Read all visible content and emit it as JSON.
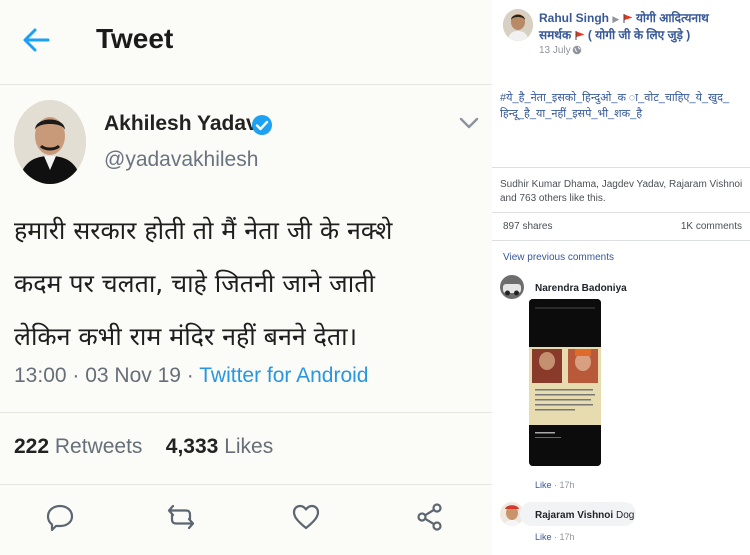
{
  "tweet": {
    "header_title": "Tweet",
    "author_name": "Akhilesh Yadav",
    "author_handle": "@yadavakhilesh",
    "body_lines": [
      "हमारी सरकार होती तो मैं नेता जी के नक्शे",
      "कदम पर चलता, चाहे जितनी जाने जाती",
      "लेकिन कभी राम मंदिर नहीं बनने देता।"
    ],
    "time": "13:00 · 03 Nov 19 · ",
    "source": "Twitter for Android",
    "retweets_count": "222",
    "retweets_label": "Retweets",
    "likes_count": "4,333",
    "likes_label": "Likes",
    "accent_color": "#1da1f2"
  },
  "facebook": {
    "poster_name": "Rahul Singh",
    "group_name": "योगी आदित्यनाथ समर्थक",
    "group_suffix": "( योगी जी के लिए जुड़े )",
    "post_time": "13 July",
    "hashtag_text": "#ये_है_नेता_इसको_हिन्दुओ_क ा_वोट_चाहिए_ये_खुद_हिन्दू_है_या_नहीं_इसपे_भी_शक_है",
    "likers_text": "Sudhir Kumar Dhama, Jagdev Yadav, Rajaram Vishnoi and 763 others like this.",
    "shares": "897 shares",
    "comments": "1K comments",
    "view_previous": "View previous comments",
    "comment1": {
      "author": "Narendra Badoniya",
      "like": "Like",
      "time": "· 17h"
    },
    "comment2": {
      "author": "Rajaram Vishnoi",
      "text": "Dog",
      "like": "Like",
      "time": "· 17h"
    },
    "link_color": "#385898"
  }
}
